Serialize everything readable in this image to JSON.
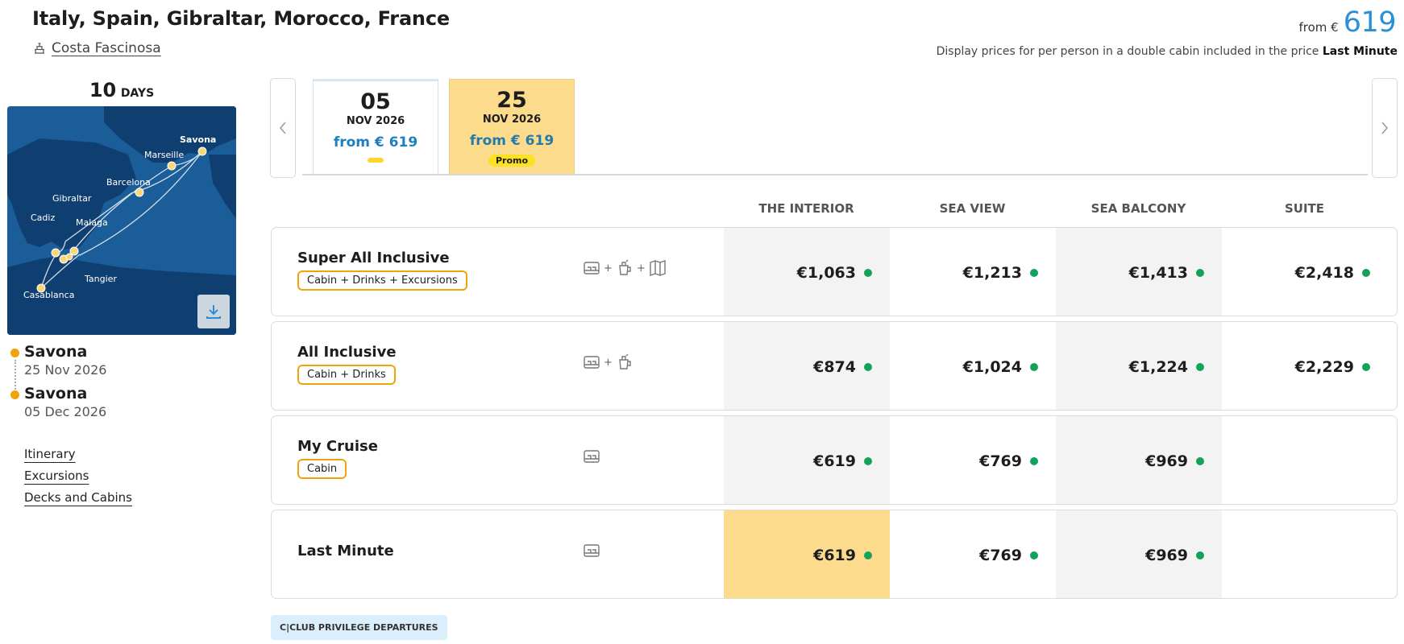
{
  "header": {
    "title": "Italy, Spain, Gibraltar, Morocco, France",
    "ship_name": "Costa Fascinosa",
    "from_label": "from €",
    "from_price": "619",
    "price_note_prefix": "Display prices for per person in a double cabin included in the price",
    "price_note_bold": "Last Minute"
  },
  "sidebar": {
    "days_num": "10",
    "days_label": "DAYS",
    "map_labels": [
      "Savona",
      "Marseille",
      "Barcelona",
      "Gibraltar",
      "Cadiz",
      "Malaga",
      "Tangier",
      "Casablanca"
    ],
    "ports": [
      {
        "name": "Savona",
        "date": "25 Nov 2026"
      },
      {
        "name": "Savona",
        "date": "05 Dec 2026"
      }
    ],
    "links": [
      "Itinerary",
      "Excursions",
      "Decks and Cabins"
    ]
  },
  "dates": [
    {
      "day": "05",
      "month": "NOV 2026",
      "from": "from € 619",
      "badge": ""
    },
    {
      "day": "25",
      "month": "NOV 2026",
      "from": "from € 619",
      "badge": "Promo"
    }
  ],
  "columns": [
    "THE INTERIOR",
    "SEA VIEW",
    "SEA BALCONY",
    "SUITE"
  ],
  "rows": [
    {
      "label": "Super All Inclusive",
      "tag": "Cabin + Drinks + Excursions",
      "prices": [
        "€1,063",
        "€1,213",
        "€1,413",
        "€2,418"
      ]
    },
    {
      "label": "All Inclusive",
      "tag": "Cabin + Drinks",
      "prices": [
        "€874",
        "€1,024",
        "€1,224",
        "€2,229"
      ]
    },
    {
      "label": "My Cruise",
      "tag": "Cabin",
      "prices": [
        "€619",
        "€769",
        "€969",
        ""
      ]
    },
    {
      "label": "Last Minute",
      "tag": "",
      "prices": [
        "€619",
        "€769",
        "€969",
        ""
      ]
    }
  ],
  "club_label": "C|CLUB PRIVILEGE DEPARTURES",
  "colors": {
    "accent_blue": "#2b8fd6",
    "highlight_yellow": "#fcdc8c",
    "available_green": "#12a35a",
    "tag_orange": "#f0a30a"
  }
}
